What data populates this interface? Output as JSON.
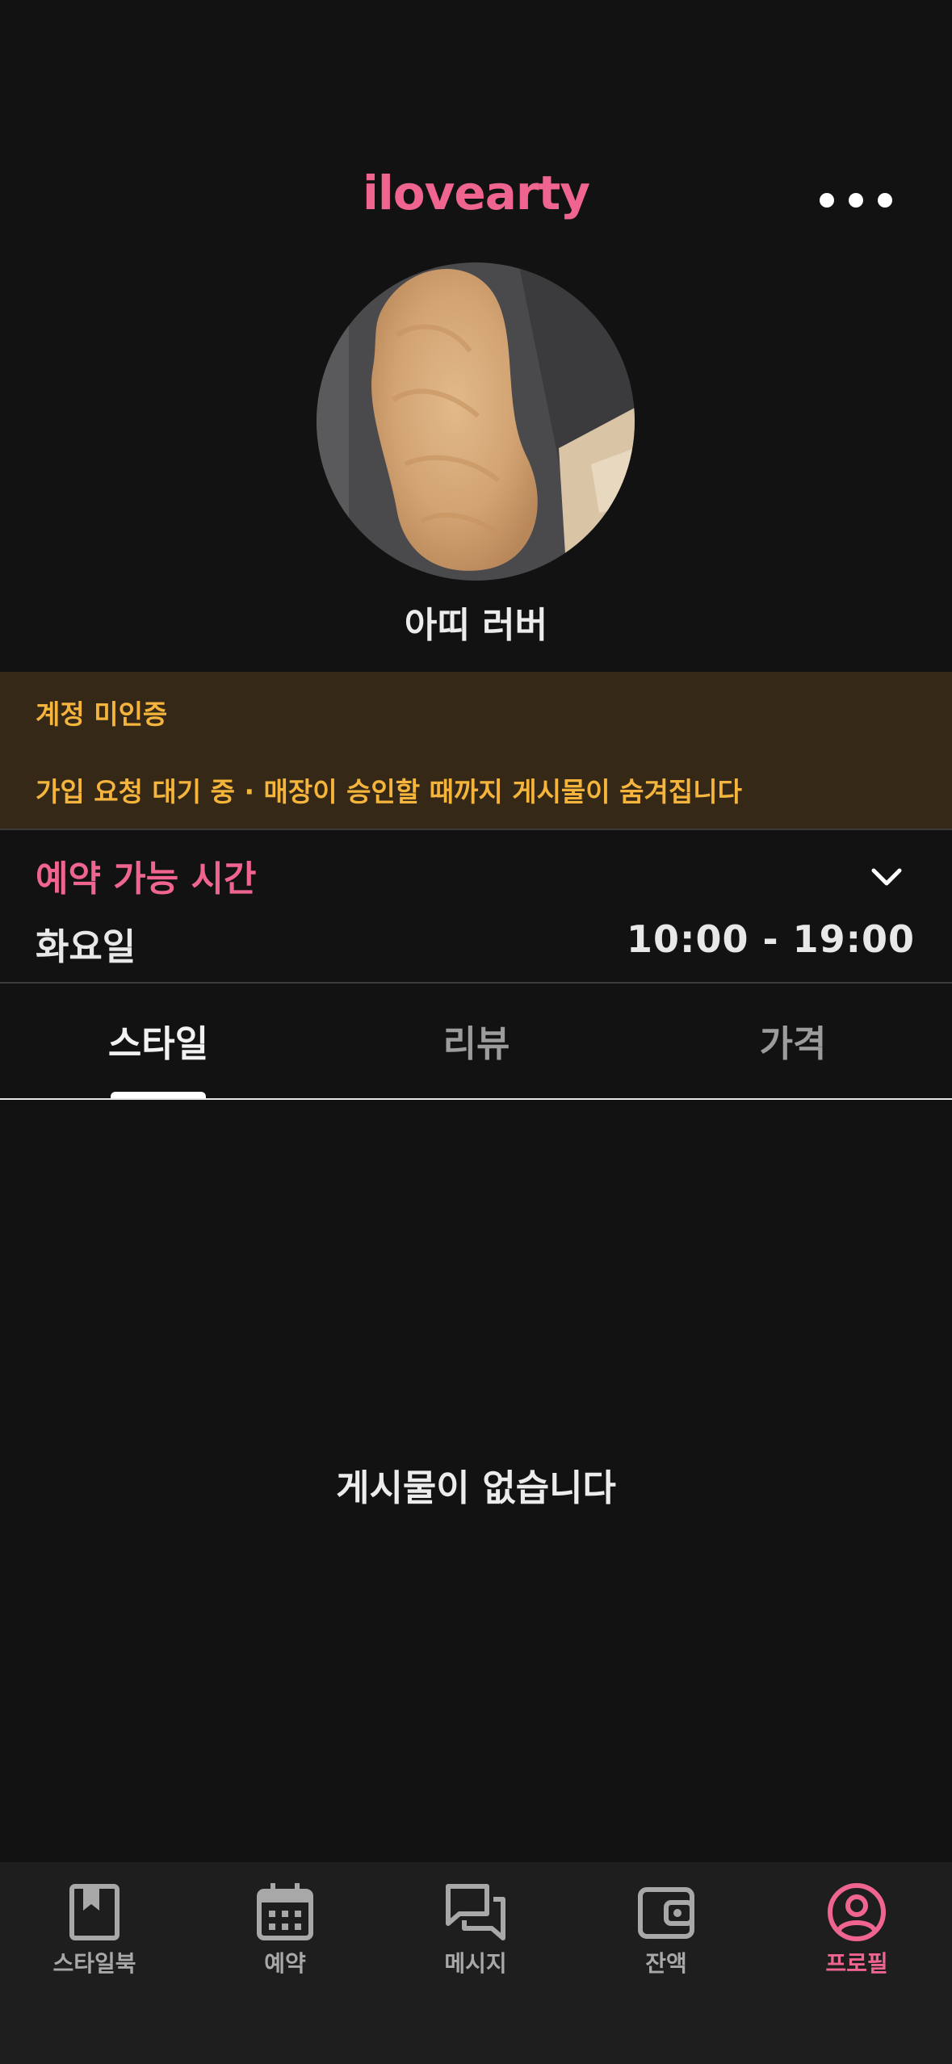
{
  "header": {
    "username": "ilovearty",
    "nickname": "아띠 러버"
  },
  "warning": {
    "title": "계정 미인증",
    "message": "가입 요청 대기 중 · 매장이 승인할 때까지 게시물이 숨겨집니다"
  },
  "hours": {
    "title": "예약 가능 시간",
    "day": "화요일",
    "time": "10:00 - 19:00"
  },
  "tabs": [
    {
      "label": "스타일"
    },
    {
      "label": "리뷰"
    },
    {
      "label": "가격"
    }
  ],
  "empty_state": "게시물이 없습니다",
  "bottom_nav": [
    {
      "label": "스타일북",
      "icon": "book-icon"
    },
    {
      "label": "예약",
      "icon": "calendar-icon"
    },
    {
      "label": "메시지",
      "icon": "chat-icon"
    },
    {
      "label": "잔액",
      "icon": "wallet-icon"
    },
    {
      "label": "프로필",
      "icon": "profile-icon"
    }
  ],
  "colors": {
    "accent": "#ef6590",
    "warning_text": "#f5b43c",
    "warning_bg": "#352816",
    "background": "#121212",
    "nav_bg": "#1e1e1e"
  }
}
